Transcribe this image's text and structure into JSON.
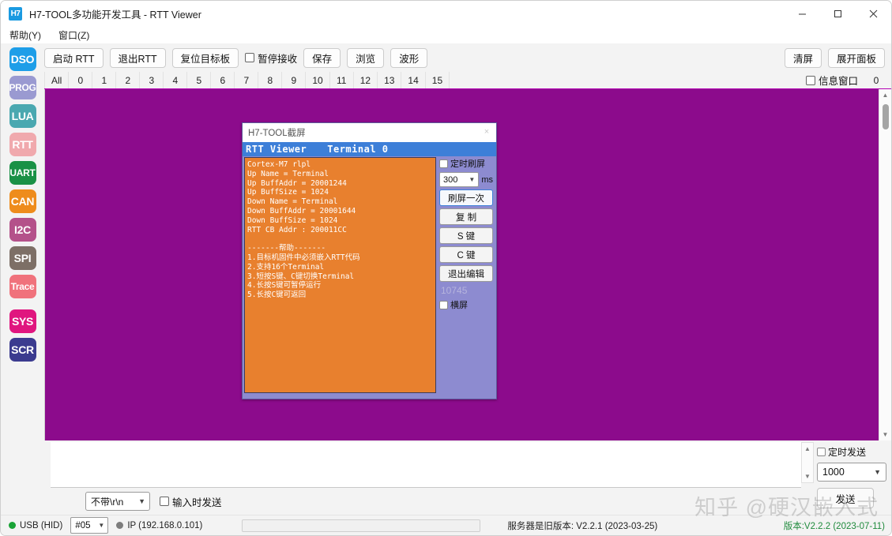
{
  "window": {
    "badge": "H7",
    "title": "H7-TOOL多功能开发工具 - RTT Viewer",
    "minimize": "minimize-icon",
    "maximize": "maximize-icon",
    "close": "close-icon"
  },
  "menubar": {
    "items": [
      {
        "label": "帮助(Y)"
      },
      {
        "label": "窗口(Z)"
      }
    ]
  },
  "sidebar": {
    "items": [
      {
        "label": "DSO",
        "color": "#1e9ee8"
      },
      {
        "label": "PROG",
        "color": "#9a9ad1"
      },
      {
        "label": "LUA",
        "color": "#4aa8b0"
      },
      {
        "label": "RTT",
        "color": "#f0a9ad"
      },
      {
        "label": "UART",
        "color": "#1a9146"
      },
      {
        "label": "CAN",
        "color": "#ee8c1c"
      },
      {
        "label": "I2C",
        "color": "#b4518a"
      },
      {
        "label": "SPI",
        "color": "#7d6f66"
      },
      {
        "label": "Trace",
        "color": "#f0727c"
      },
      {
        "label": "SYS",
        "color": "#e0167f"
      },
      {
        "label": "SCR",
        "color": "#3b3b8f"
      }
    ]
  },
  "toolbar": {
    "start_rtt": "启动 RTT",
    "exit_rtt": "退出RTT",
    "reset_target": "复位目标板",
    "pause_recv": "暂停接收",
    "save": "保存",
    "browse": "浏览",
    "waveform": "波形",
    "clear_screen": "清屏",
    "expand_panel": "展开面板"
  },
  "tabs": {
    "items": [
      "All",
      "0",
      "1",
      "2",
      "3",
      "4",
      "5",
      "6",
      "7",
      "8",
      "9",
      "10",
      "11",
      "12",
      "13",
      "14",
      "15"
    ],
    "info_window": "信息窗口",
    "counter": "0"
  },
  "shot_window": {
    "title": "H7-TOOL截屏",
    "close": "×",
    "header_left": "RTT Viewer",
    "header_right": "Terminal 0",
    "terminal_text": "Cortex-M7 rlpl\nUp Name = Terminal\nUp BuffAddr = 20001244\nUp BuffSize = 1024\nDown Name = Terminal\nDown BuffAddr = 20001644\nDown BuffSize = 1024\nRTT CB Addr : 200011CC\n\n-------帮助-------\n1.目标机固件中必须嵌入RTT代码\n2.支持16个Terminal\n3.短按S键、C键切换Terminal\n4.长按S键可暂停运行\n5.长按C键可返回",
    "panel": {
      "timer_refresh": "定时刷屏",
      "interval_value": "300",
      "interval_unit": "ms",
      "refresh_once": "刷屏一次",
      "copy": "复 制",
      "s_key": "S 键",
      "c_key": "C 键",
      "exit_edit": "退出编辑",
      "counter": "10745",
      "landscape": "横屏"
    }
  },
  "send_area": {
    "crlf_option": "不带\\r\\n",
    "send_on_input": "输入时发送",
    "timed_send": "定时发送",
    "timed_interval": "1000",
    "send_button": "发送"
  },
  "statusbar": {
    "usb": "USB (HID)",
    "device": "#05",
    "ip": "IP (192.168.0.101)",
    "server": "服务器是旧版本: V2.2.1 (2023-03-25)",
    "version": "版本:V2.2.2 (2023-07-11)",
    "usb_dot_color": "#19a336",
    "ip_dot_color": "#7d7d7d",
    "version_color": "#1f8a3c"
  },
  "watermark": {
    "text": "知乎 @硬汉嵌入式"
  }
}
